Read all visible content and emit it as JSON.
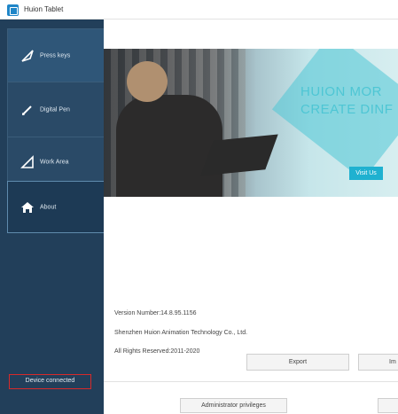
{
  "window": {
    "title": "Huion Tablet"
  },
  "sidebar": {
    "items": [
      {
        "label": "Press keys",
        "icon": "pen-nib-icon"
      },
      {
        "label": "Digital Pen",
        "icon": "pen-icon"
      },
      {
        "label": "Work Area",
        "icon": "triangle-ruler-icon"
      },
      {
        "label": "About",
        "icon": "home-icon"
      }
    ],
    "status": "Device connected"
  },
  "banner": {
    "line1": "HUION MOR",
    "line2": "CREATE DINF",
    "visit_label": "Visit Us"
  },
  "about": {
    "version": "Version Number:14.8.95.1156",
    "company": "Shenzhen Huion Animation Technology Co., Ltd.",
    "rights": "All Rights Reserved:2011-2020",
    "export_label": "Export",
    "import_label": "Im"
  },
  "footer": {
    "admin_label": "Administrator privileges"
  },
  "colors": {
    "sidebar": "#223f5a",
    "nav_active_border": "#5f8bad",
    "accent": "#1fb1d0",
    "status_highlight": "#d62a2a"
  }
}
